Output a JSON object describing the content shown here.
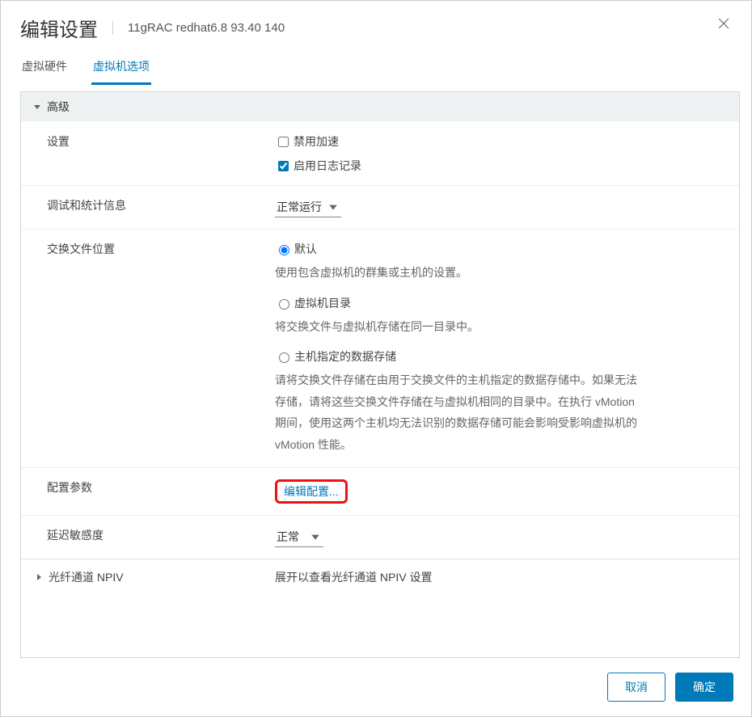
{
  "header": {
    "title": "编辑设置",
    "subtitle": "11gRAC redhat6.8 93.40 140"
  },
  "tabs": [
    {
      "label": "虚拟硬件",
      "active": false
    },
    {
      "label": "虚拟机选项",
      "active": true
    }
  ],
  "sections": {
    "advanced": {
      "title": "高级",
      "settings_label": "设置",
      "disable_accel_label": "禁用加速",
      "disable_accel_checked": false,
      "enable_logging_label": "启用日志记录",
      "enable_logging_checked": true,
      "debug_label": "调试和统计信息",
      "debug_value": "正常运行",
      "swap_label": "交换文件位置",
      "swap_options": [
        {
          "label": "默认",
          "desc": "使用包含虚拟机的群集或主机的设置。",
          "selected": true
        },
        {
          "label": "虚拟机目录",
          "desc": "将交换文件与虚拟机存储在同一目录中。",
          "selected": false
        },
        {
          "label": "主机指定的数据存储",
          "desc": "请将交换文件存储在由用于交换文件的主机指定的数据存储中。如果无法存储，请将这些交换文件存储在与虚拟机相同的目录中。在执行 vMotion 期间，使用这两个主机均无法识别的数据存储可能会影响受影响虚拟机的 vMotion 性能。",
          "selected": false
        }
      ],
      "config_params_label": "配置参数",
      "config_params_link": "编辑配置...",
      "latency_label": "延迟敏感度",
      "latency_value": "正常"
    },
    "npiv": {
      "title": "光纤通道 NPIV",
      "summary": "展开以查看光纤通道 NPIV 设置"
    }
  },
  "footer": {
    "cancel": "取消",
    "ok": "确定"
  }
}
